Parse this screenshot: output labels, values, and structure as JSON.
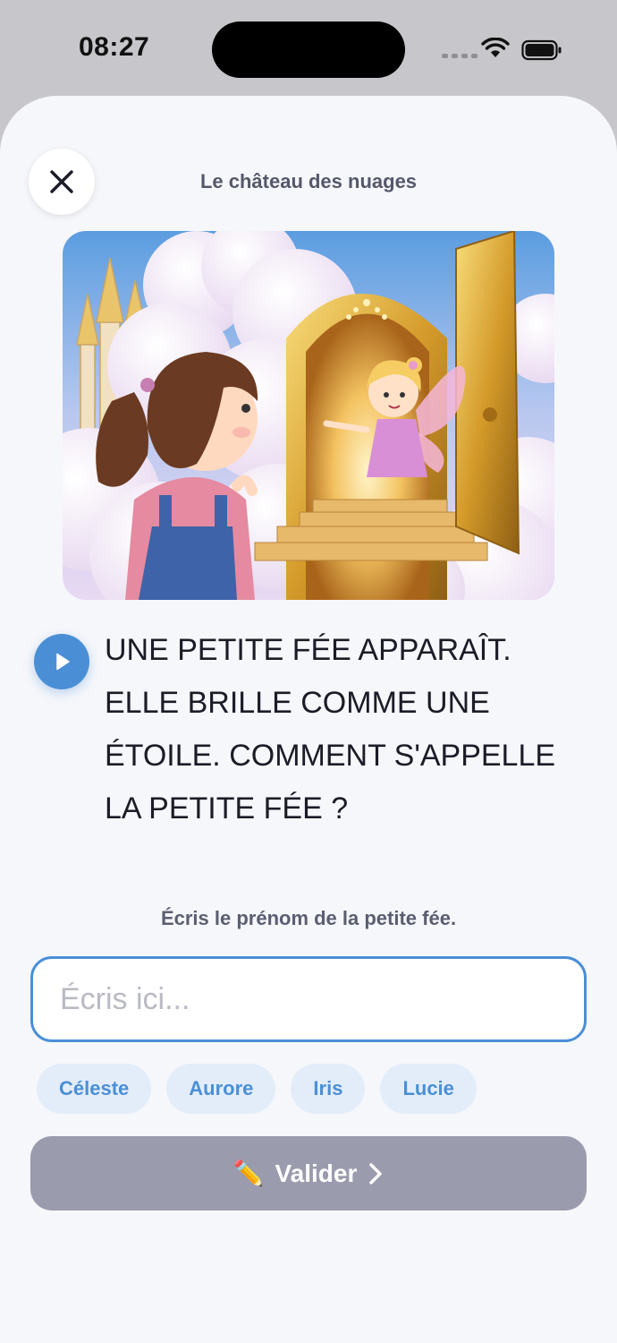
{
  "status_bar": {
    "time": "08:27"
  },
  "header": {
    "title": "Le château des nuages"
  },
  "story": {
    "lines": [
      "UNE PETITE FÉE APPARAÎT.",
      "ELLE BRILLE COMME UNE",
      "ÉTOILE. COMMENT S'APPELLE",
      "LA PETITE FÉE ?"
    ]
  },
  "question": {
    "prompt": "Écris le prénom de la petite fée.",
    "placeholder": "Écris ici...",
    "value": ""
  },
  "suggestions": [
    "Céleste",
    "Aurore",
    "Iris",
    "Lucie"
  ],
  "submit": {
    "icon": "✏️",
    "label": "Valider"
  },
  "icons": {
    "close": "close-icon",
    "play": "play-icon",
    "chevron": "chevron-right-icon"
  },
  "colors": {
    "accent": "#4a8fd6",
    "chip_bg": "#e3edf9",
    "button_disabled": "#9a9bad",
    "sheet_bg": "#f6f7fb"
  }
}
